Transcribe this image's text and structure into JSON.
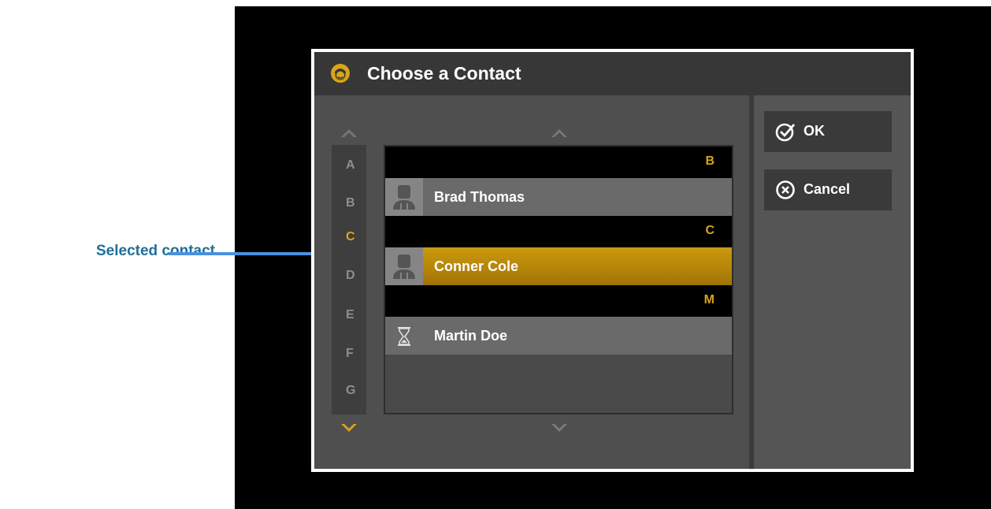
{
  "callout": {
    "label": "Selected contact"
  },
  "dialog": {
    "title": "Choose a Contact",
    "title_icon": "contact-head-icon",
    "accent_color": "#d8a51a"
  },
  "alphabet": {
    "letters": [
      "A",
      "B",
      "C",
      "D",
      "E",
      "F",
      "G"
    ],
    "active": "C"
  },
  "contacts": {
    "sections": [
      {
        "letter": "B",
        "rows": [
          {
            "name": "Brad Thomas",
            "icon": "person-icon",
            "selected": false
          }
        ]
      },
      {
        "letter": "C",
        "rows": [
          {
            "name": "Conner Cole",
            "icon": "person-icon",
            "selected": true
          }
        ]
      },
      {
        "letter": "M",
        "rows": [
          {
            "name": "Martin Doe",
            "icon": "hourglass-icon",
            "selected": false
          }
        ]
      }
    ]
  },
  "buttons": {
    "ok": {
      "label": "OK",
      "icon": "check-circle-icon"
    },
    "cancel": {
      "label": "Cancel",
      "icon": "x-circle-icon"
    }
  }
}
